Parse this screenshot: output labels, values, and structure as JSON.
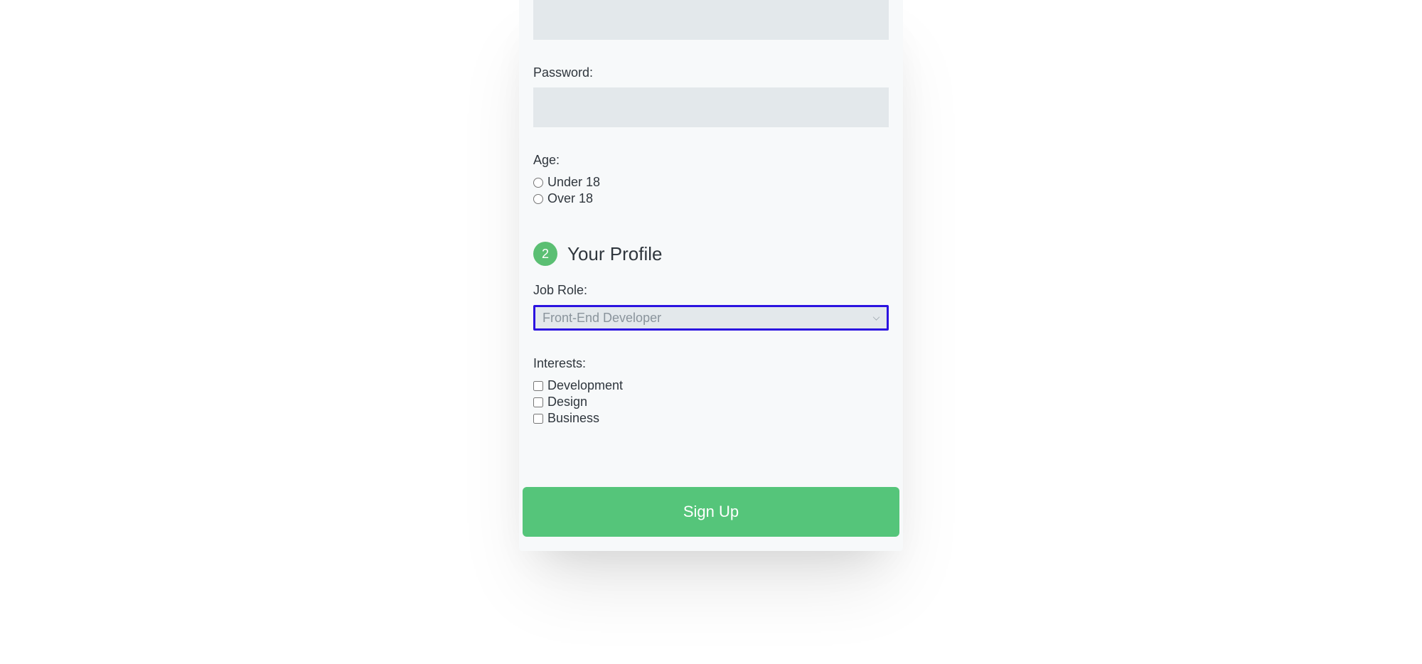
{
  "form": {
    "password": {
      "label": "Password:"
    },
    "age": {
      "label": "Age:",
      "options": {
        "under18": "Under 18",
        "over18": "Over 18"
      }
    },
    "section2": {
      "badge": "2",
      "title": "Your Profile"
    },
    "jobRole": {
      "label": "Job Role:",
      "selected": "Front-End Developer"
    },
    "interests": {
      "label": "Interests:",
      "options": {
        "development": "Development",
        "design": "Design",
        "business": "Business"
      }
    },
    "submit": {
      "label": "Sign Up"
    }
  }
}
